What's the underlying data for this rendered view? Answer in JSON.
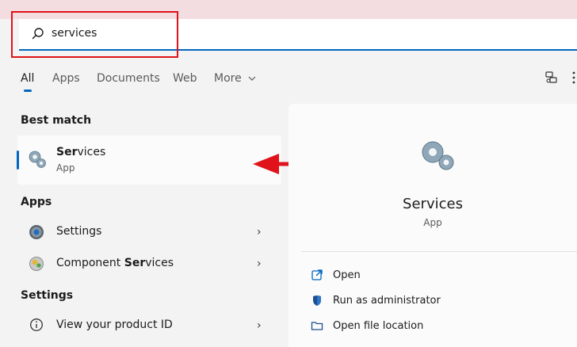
{
  "search": {
    "value": "services",
    "typed_prefix": "ser",
    "rest": "vices"
  },
  "tabs": [
    {
      "label": "All"
    },
    {
      "label": "Apps"
    },
    {
      "label": "Documents"
    },
    {
      "label": "Web"
    },
    {
      "label": "More"
    }
  ],
  "best_match": {
    "heading": "Best match",
    "title_bold": "Ser",
    "title_rest": "vices",
    "subtitle": "App"
  },
  "apps": {
    "heading": "Apps",
    "items": [
      {
        "label": "Settings",
        "icon": "settings-gear-icon"
      },
      {
        "label_plain": "Component ",
        "label_bold": "Ser",
        "label_rest": "vices",
        "icon": "component-services-icon"
      }
    ]
  },
  "settings": {
    "heading": "Settings",
    "items": [
      {
        "label": "View your product ID",
        "icon": "info-icon"
      }
    ]
  },
  "preview": {
    "title": "Services",
    "subtitle": "App",
    "actions": [
      {
        "label": "Open",
        "icon": "open-icon"
      },
      {
        "label": "Run as administrator",
        "icon": "shield-icon"
      },
      {
        "label": "Open file location",
        "icon": "folder-icon"
      }
    ]
  },
  "colors": {
    "accent": "#0067c0",
    "highlight": "#e0121a"
  }
}
